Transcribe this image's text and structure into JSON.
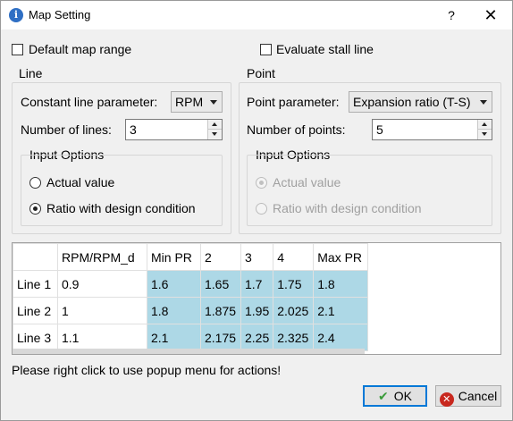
{
  "window": {
    "title": "Map Setting",
    "help": "?",
    "close": "✕",
    "app_icon": "info-icon"
  },
  "options": {
    "default_map_range": "Default map range",
    "evaluate_stall_line": "Evaluate stall line"
  },
  "line": {
    "title": "Line",
    "param_label": "Constant line parameter:",
    "param_value": "RPM",
    "count_label": "Number of lines:",
    "count_value": "3",
    "input_title": "Input Options",
    "actual": "Actual value",
    "ratio": "Ratio with design condition"
  },
  "point": {
    "title": "Point",
    "param_label": "Point parameter:",
    "param_value": "Expansion ratio (T-S)",
    "count_label": "Number of points:",
    "count_value": "5",
    "input_title": "Input Options",
    "actual": "Actual value",
    "ratio": "Ratio with design condition"
  },
  "table": {
    "headers": [
      "",
      "RPM/RPM_d",
      "Min PR",
      "2",
      "3",
      "4",
      "Max PR"
    ],
    "rows": [
      [
        "Line 1",
        "0.9",
        "1.6",
        "1.65",
        "1.7",
        "1.75",
        "1.8"
      ],
      [
        "Line 2",
        "1",
        "1.8",
        "1.875",
        "1.95",
        "2.025",
        "2.1"
      ],
      [
        "Line 3",
        "1.1",
        "2.1",
        "2.175",
        "2.25",
        "2.325",
        "2.4"
      ]
    ]
  },
  "footer": {
    "message": "Please right click to use popup menu for actions!",
    "ok": "OK",
    "cancel": "Cancel"
  },
  "colors": {
    "highlight": "#add8e6",
    "accent": "#0078d7"
  }
}
